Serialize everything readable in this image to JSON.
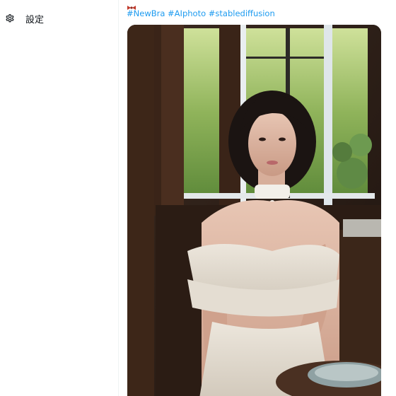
{
  "sidebar": {
    "settings": {
      "label": "設定",
      "icon": "gear-icon"
    }
  },
  "tweet": {
    "emoji": "ribbon-emoji",
    "hashtags": [
      "#NewBra",
      "#AIphoto",
      "#stablediffusion"
    ],
    "media": {
      "type": "photo"
    }
  },
  "colors": {
    "link": "#1d9bf0",
    "text": "#0f1419",
    "divider": "#eff3f4"
  }
}
